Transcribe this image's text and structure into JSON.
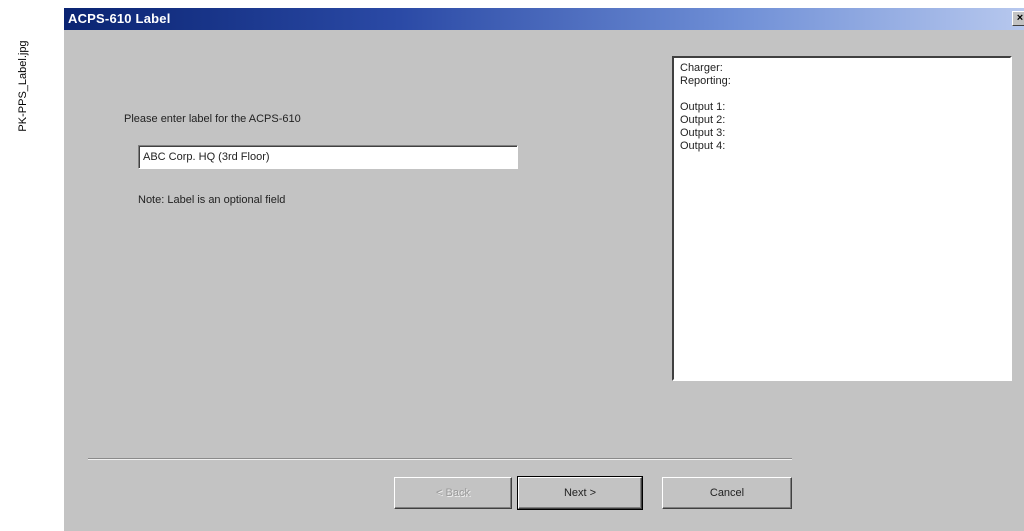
{
  "caption": "PK-PPS_Label.jpg",
  "window": {
    "title": "ACPS-610 Label",
    "close_glyph": "×"
  },
  "form": {
    "prompt": "Please enter label for the ACPS-610",
    "label_value": "ABC Corp. HQ (3rd Floor)",
    "note": "Note: Label is an optional field"
  },
  "summary": {
    "charger": "Charger:",
    "reporting": "Reporting:",
    "outputs": [
      "Output 1:",
      "Output 2:",
      "Output 3:",
      "Output 4:"
    ]
  },
  "buttons": {
    "back_label": "< Back",
    "next_label": "Next >",
    "cancel_label": "Cancel"
  },
  "icons": {
    "close": "close-icon"
  }
}
